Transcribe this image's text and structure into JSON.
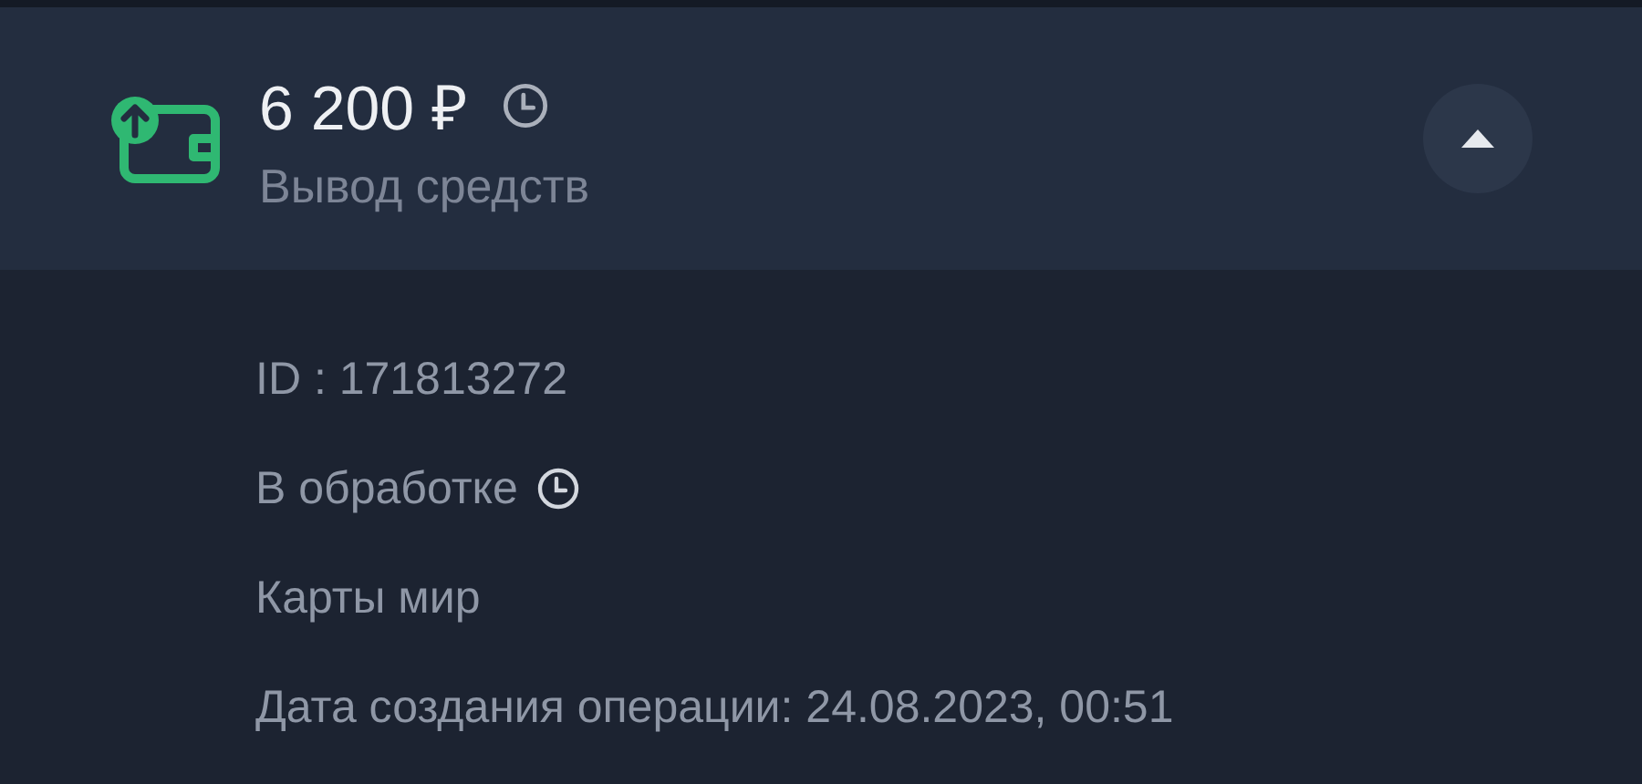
{
  "transaction": {
    "amount": "6 200 ₽",
    "title": "Вывод средств",
    "expanded": true,
    "details": [
      {
        "kind": "plain",
        "text": "ID : 171813272"
      },
      {
        "kind": "status",
        "text": "В обработке"
      },
      {
        "kind": "plain",
        "text": "Карты мир"
      },
      {
        "kind": "plain",
        "text": "Дата создания операции: 24.08.2023, 00:51"
      }
    ]
  }
}
